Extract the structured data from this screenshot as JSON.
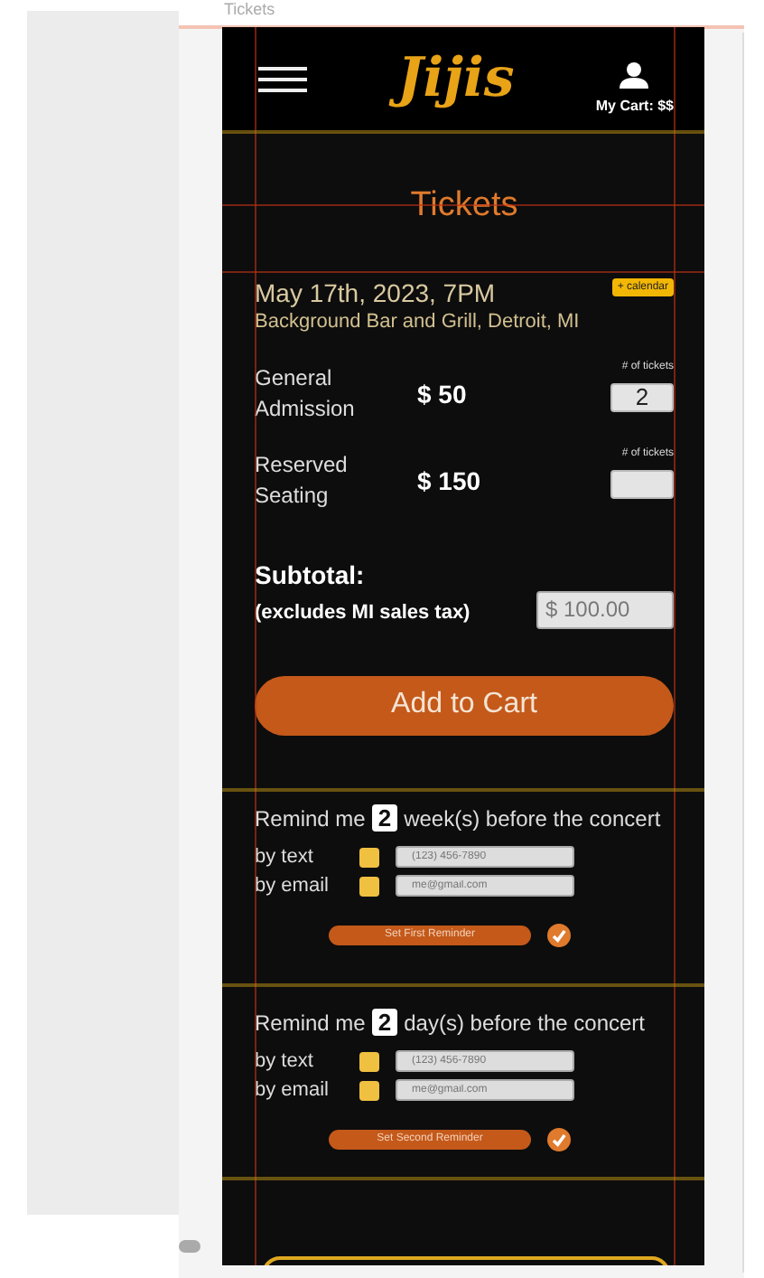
{
  "frame_label": "Tickets",
  "header": {
    "logo": "Jijis",
    "cart": "My Cart: $$"
  },
  "heading": "Tickets",
  "event": {
    "date": "May 17th, 2023, 7PM",
    "calendar_button": "+ calendar",
    "venue": "Background Bar and Grill, Detroit, MI"
  },
  "tickets": [
    {
      "name": "General Admission",
      "price": "$ 50",
      "quantity_label": "# of tickets",
      "quantity": "2"
    },
    {
      "name": "Reserved Seating",
      "price": "$ 150",
      "quantity_label": "# of tickets"
    }
  ],
  "subtotal": {
    "label": "Subtotal:",
    "note": "(excludes MI sales tax)",
    "value": "$ 100.00"
  },
  "add_button": "Add to Cart",
  "reminders": [
    {
      "prefix": "Remind me",
      "count": "2",
      "suffix": "week(s) before the concert",
      "channels": [
        {
          "label": "by text",
          "checked": false,
          "placeholder": "(123) 456-7890"
        },
        {
          "label": "by email",
          "checked": false,
          "placeholder": "me@gmail.com"
        }
      ],
      "button": "Set First Reminder",
      "confirmed": true
    },
    {
      "prefix": "Remind me",
      "count": "2",
      "suffix": "day(s) before the concert",
      "channels": [
        {
          "label": "by text",
          "checked": false,
          "placeholder": "(123) 456-7890"
        },
        {
          "label": "by email",
          "checked": false,
          "placeholder": "me@gmail.com"
        }
      ],
      "button": "Set Second Reminder",
      "confirmed": true
    }
  ]
}
